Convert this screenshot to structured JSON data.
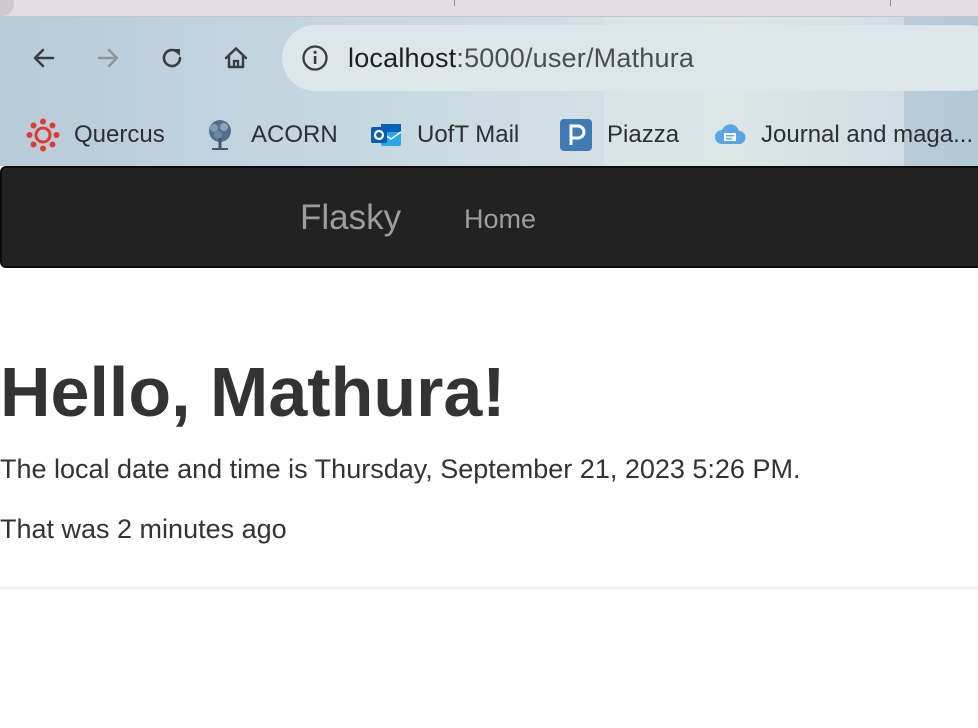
{
  "browser": {
    "address_bar": {
      "host": "localhost",
      "path": ":5000/user/Mathura"
    },
    "nav_icons": [
      "back-arrow-icon",
      "forward-arrow-icon",
      "reload-icon",
      "home-icon",
      "info-icon"
    ],
    "bookmarks": [
      {
        "label": "Quercus",
        "icon": "quercus-icon"
      },
      {
        "label": "ACORN",
        "icon": "acorn-tree-icon"
      },
      {
        "label": "UofT Mail",
        "icon": "outlook-mail-icon"
      },
      {
        "label": "Piazza",
        "icon": "piazza-icon"
      },
      {
        "label": "Journal and maga...",
        "icon": "cloud-journal-icon"
      }
    ]
  },
  "navbar": {
    "brand": "Flasky",
    "home": "Home",
    "background": "#222222",
    "link_color": "#9d9d9d"
  },
  "content": {
    "heading": "Hello, Mathura!",
    "local_time": "The local date and time is Thursday, September 21, 2023 5:26 PM.",
    "relative_time": "That was 2 minutes ago"
  }
}
